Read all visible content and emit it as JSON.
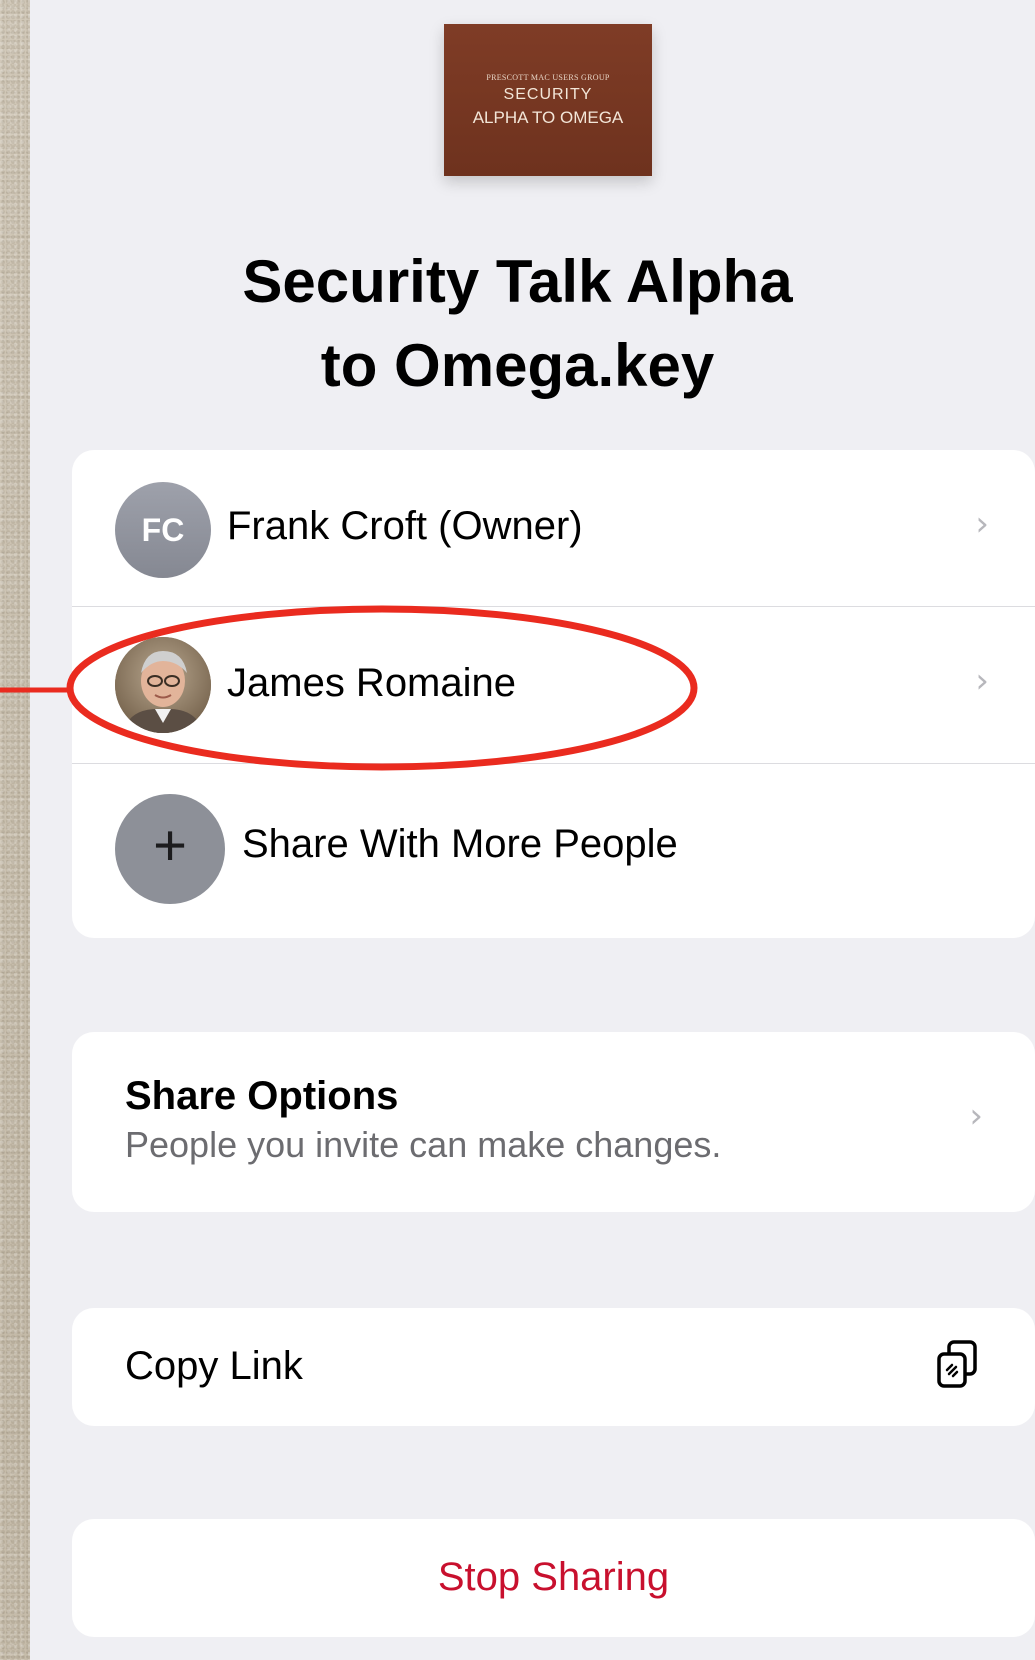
{
  "document": {
    "thumbnail": {
      "line1": "PRESCOTT MAC USERS GROUP",
      "line2": "SECURITY",
      "line3": "ALPHA TO OMEGA"
    },
    "title_line1": "Security Talk Alpha",
    "title_line2": "to Omega.key"
  },
  "people": [
    {
      "initials": "FC",
      "name": "Frank Croft (Owner)",
      "avatar": "initials"
    },
    {
      "initials": "",
      "name": "James Romaine",
      "avatar": "photo"
    }
  ],
  "add_people": {
    "label": "Share With More People",
    "icon": "plus-icon"
  },
  "share_options": {
    "title": "Share Options",
    "subtitle": "People you invite can make changes."
  },
  "copy_link": {
    "label": "Copy Link",
    "icon": "copy-link-icon"
  },
  "stop_sharing": {
    "label": "Stop Sharing"
  },
  "colors": {
    "destructive": "#c8102e",
    "annotation": "#ea2b1f",
    "thumbnail": "#7a3722"
  },
  "chevron": "›"
}
